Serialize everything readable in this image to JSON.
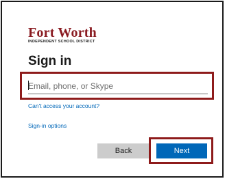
{
  "logo": {
    "title": "Fort Worth",
    "subtitle": "INDEPENDENT SCHOOL DISTRICT"
  },
  "heading": "Sign in",
  "email": {
    "value": "",
    "placeholder": "Email, phone, or Skype"
  },
  "links": {
    "cant_access": "Can't access your account?",
    "sign_in_options": "Sign-in options"
  },
  "buttons": {
    "back": "Back",
    "next": "Next"
  },
  "colors": {
    "brand": "#8a1c22",
    "accent": "#0067b8",
    "highlight": "#8e1b1b",
    "back_button": "#cccccc"
  }
}
